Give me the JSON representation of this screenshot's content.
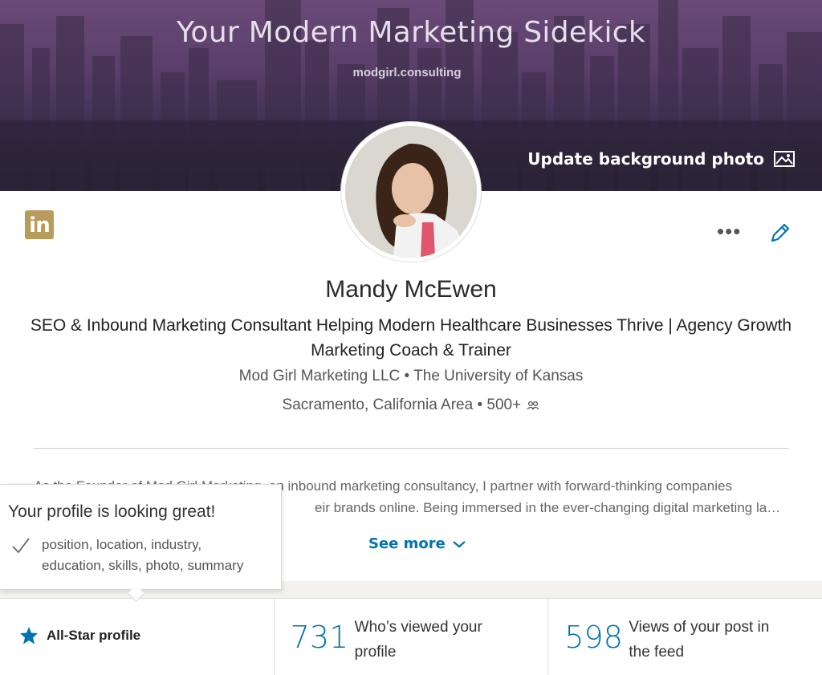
{
  "banner": {
    "title": "Your Modern Marketing Sidekick",
    "subtitle": "modgirl.consulting",
    "update_label": "Update background photo"
  },
  "profile": {
    "logo_text": "in",
    "name": "Mandy McEwen",
    "headline": "SEO & Inbound Marketing Consultant Helping Modern Healthcare Businesses Thrive | Agency Growth Marketing Coach & Trainer",
    "company": "Mod Girl Marketing LLC",
    "school": "The University of Kansas",
    "location": "Sacramento, California Area",
    "connections": "500+",
    "separator": "•",
    "more_label": "•••"
  },
  "summary": {
    "line1": "As the Founder of Mod Girl Marketing, an inbound marketing consultancy, I partner with forward-thinking companies",
    "line2": "eir brands online. Being immersed in the ever-changing digital marketing la…",
    "see_more": "See more"
  },
  "tooltip": {
    "title": "Your profile is looking great!",
    "line1": "position, location, industry,",
    "line2": "education, skills, photo, summary"
  },
  "stats": {
    "allstar_label": "All-Star profile",
    "views_count": "731",
    "views_label_1": "Who’s viewed your",
    "views_label_2": "profile",
    "post_count": "598",
    "post_label_1": "Views of your post in",
    "post_label_2": "the feed"
  },
  "colors": {
    "accent": "#0073b1",
    "logo": "#b89c5c"
  }
}
